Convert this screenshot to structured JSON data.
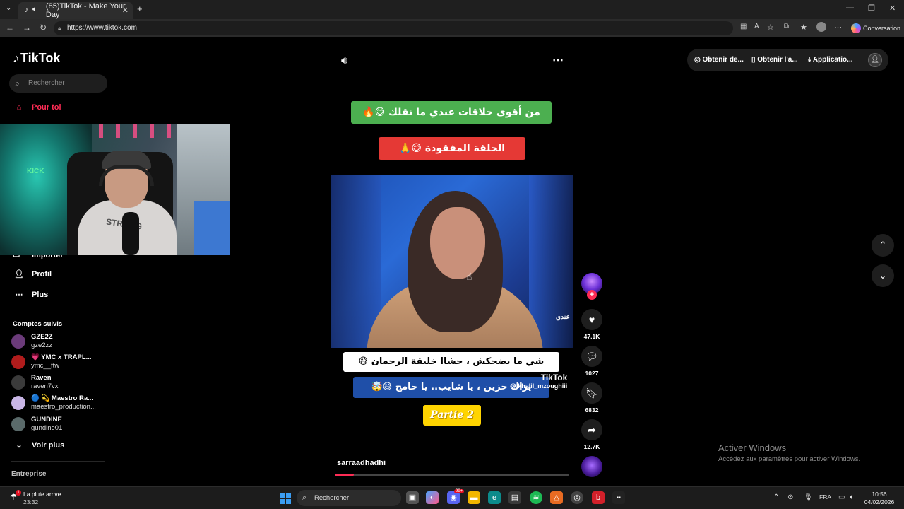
{
  "browser": {
    "tab_title": "(85)TikTok - Make Your Day",
    "url": "https://www.tiktok.com",
    "conversation_label": "Conversation"
  },
  "sidebar": {
    "logo": "TikTok",
    "search_placeholder": "Rechercher",
    "nav": {
      "for_you": "Pour toi",
      "import": "Importer",
      "profile": "Profil",
      "more": "Plus"
    },
    "followed_title": "Comptes suivis",
    "accounts": [
      {
        "name": "GZE2Z",
        "handle": "gze2zz",
        "color": "#6b3b7a"
      },
      {
        "name": "💗 YMC x TRAPL...",
        "handle": "ymc__ftw",
        "color": "#b01c1c"
      },
      {
        "name": "Raven",
        "handle": "raven7vx",
        "color": "#3b3b3b"
      },
      {
        "name": "🔵 💫 Maestro Ra...",
        "handle": "maestro_production...",
        "color": "#c9b6e6"
      },
      {
        "name": "GUNDINE",
        "handle": "gundine01",
        "color": "#5a6a6a"
      }
    ],
    "see_more": "Voir plus",
    "enterprise": "Entreprise"
  },
  "header": {
    "get_coins": "Obtenir de...",
    "get_app": "Obtenir l'a...",
    "application": "Applicatio..."
  },
  "video": {
    "banner_top": "من أقوى حلاقات عندي ما نقلك 😅🔥",
    "banner_second": "الحلقة المفقودة 😅🙏",
    "channel_tag": "عندي",
    "subtitle_white": "شي ما يضحكش ، حشاا خليقة الرحمان 😅",
    "subtitle_blue": "يراك حزين ، يا شايب.. يا خامج 😅🤯",
    "watermark_brand": "TikTok",
    "watermark_handle": "@ khalil_mzoughiii",
    "partie": "Partie 2",
    "author": "sarraadhadhi",
    "progress": 0.08
  },
  "actions": {
    "likes": "47.1K",
    "comments": "1027",
    "saves": "6832",
    "shares": "12.7K"
  },
  "windows_activation": {
    "title": "Activer Windows",
    "subtitle": "Accédez aux paramètres pour activer Windows."
  },
  "taskbar": {
    "weather_title": "La pluie arrive",
    "weather_time": "23:32",
    "search_placeholder": "Rechercher",
    "language": "FRA",
    "time": "10:56",
    "date": "04/02/2026",
    "notif_badge": "99+"
  }
}
